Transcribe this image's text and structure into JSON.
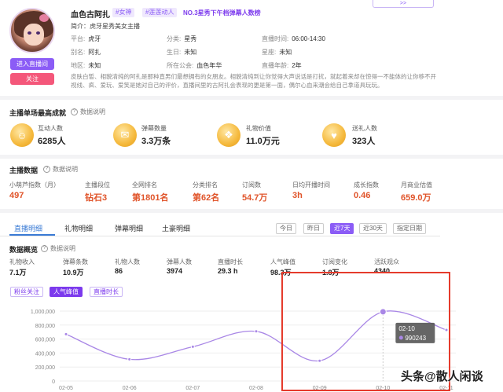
{
  "profile": {
    "name": "血色古阿扎",
    "tags": [
      "#女神",
      "#莲莲动人"
    ],
    "rank_line": "NO.3星秀下午档弹幕人数榜",
    "top_button": ">>",
    "intro": "简介：虎牙星秀美女主播",
    "enter_room": "进入直播间",
    "follow": "关注",
    "info": [
      {
        "label": "平台:",
        "value": "虎牙"
      },
      {
        "label": "分类:",
        "value": "星秀"
      },
      {
        "label": "直播时间:",
        "value": "06:00-14:30"
      },
      {
        "label": "别名:",
        "value": "阿扎"
      },
      {
        "label": "生日:",
        "value": "未知"
      },
      {
        "label": "星座:",
        "value": "未知"
      },
      {
        "label": "地区:",
        "value": "未知"
      },
      {
        "label": "所在公会:",
        "value": "血色年华"
      },
      {
        "label": "直播年龄:",
        "value": "2年"
      }
    ],
    "description": "皮肤白皙、相貌清纯的阿扎是那种直男们最想拥有的女朋友。相貌清纯到让你觉得大声说话是打扰，就起着来却在惊得一不能体的让你移不开视线、疯、爱玩、爱笑是她对自己的评价，直播间里的古阿扎会表现的更是第一面，偶尔心血来潮会给自己拿道具玩玩。"
  },
  "best_score": {
    "title": "主播单场最高成就",
    "help": "数据说明",
    "items": [
      {
        "icon": "person-coin-icon",
        "glyph": "☺",
        "label": "互动人数",
        "value": "6285人"
      },
      {
        "icon": "danmu-coin-icon",
        "glyph": "✉",
        "label": "弹幕数量",
        "value": "3.3万条"
      },
      {
        "icon": "gift-coin-icon",
        "glyph": "❖",
        "label": "礼物价值",
        "value": "11.0万元"
      },
      {
        "icon": "gift-user-coin-icon",
        "glyph": "♥",
        "label": "送礼人数",
        "value": "323人"
      }
    ]
  },
  "anchor_data": {
    "title": "主播数据",
    "help": "数据说明",
    "items": [
      {
        "label": "小萌芦指数（月）",
        "value": "497"
      },
      {
        "label": "主播段位",
        "value": "钻石3"
      },
      {
        "label": "全网排名",
        "value": "第1801名"
      },
      {
        "label": "分类排名",
        "value": "第62名"
      },
      {
        "label": "订阅数",
        "value": "54.7万"
      },
      {
        "label": "日均开播时间",
        "value": "3h"
      },
      {
        "label": "成长指数",
        "value": "0.46"
      },
      {
        "label": "月商业估值",
        "value": "659.0万"
      }
    ]
  },
  "tabs": [
    "直播明细",
    "礼物明细",
    "弹幕明细",
    "土豪明细"
  ],
  "ranges": [
    "今日",
    "昨日",
    "近7天",
    "近30天",
    "指定日期"
  ],
  "active_range": "近7天",
  "overview": {
    "title": "数据概览",
    "help": "数据说明",
    "items": [
      {
        "label": "礼物收入",
        "value": "7.1万"
      },
      {
        "label": "弹幕条数",
        "value": "10.9万"
      },
      {
        "label": "礼物人数",
        "value": "86"
      },
      {
        "label": "弹幕人数",
        "value": "3974"
      },
      {
        "label": "直播时长",
        "value": "29.3 h"
      },
      {
        "label": "人气峰值",
        "value": "98.3万"
      },
      {
        "label": "订阅变化",
        "value": "1.8万"
      },
      {
        "label": "活跃观众",
        "value": "4340"
      }
    ]
  },
  "pills": [
    "粉丝关注",
    "人气峰值",
    "直播时长"
  ],
  "active_pill": "人气峰值",
  "chart_data": {
    "type": "line",
    "x": [
      "02-05",
      "02-06",
      "02-07",
      "02-08",
      "02-09",
      "02-10",
      "02-11"
    ],
    "values": [
      670000,
      310000,
      490000,
      710000,
      290000,
      990243,
      730000
    ],
    "yticks": [
      "1,000,000",
      "800,000",
      "600,000",
      "400,000",
      "200,000",
      "0"
    ],
    "ylim": [
      0,
      1000000
    ],
    "tooltip": {
      "date": "02-10",
      "value": "990243"
    },
    "line_color": "#a987e6"
  },
  "watermark": "头条@散人闲谈"
}
